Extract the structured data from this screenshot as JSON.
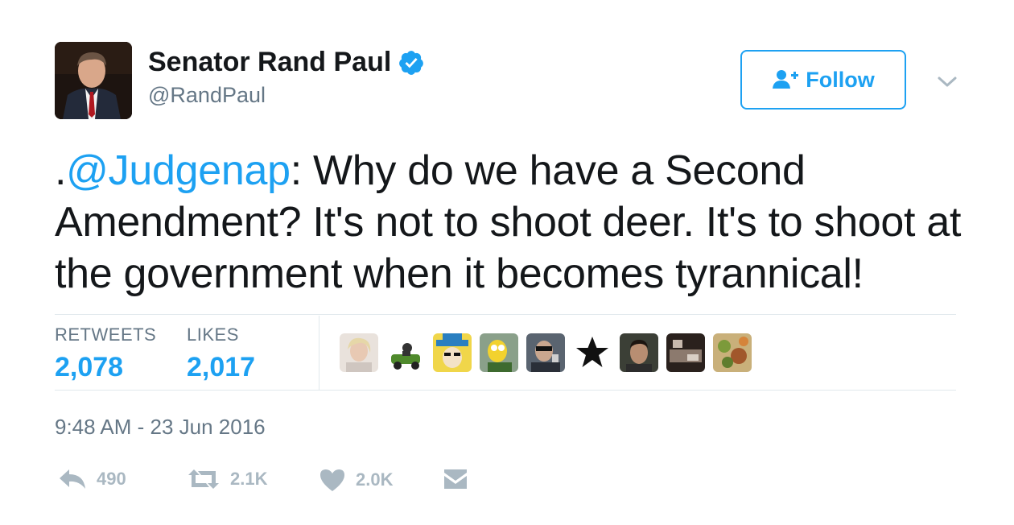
{
  "tweet": {
    "display_name": "Senator Rand Paul",
    "handle": "@RandPaul",
    "verified_icon": "verified-badge-icon",
    "follow_label": "Follow",
    "text_prefix": ".",
    "mention": "@Judgenap",
    "text_body": ": Why do we have a Second Amendment? It's not to shoot deer. It's to shoot at the government when it becomes tyrannical!",
    "timestamp": "9:48 AM - 23 Jun 2016"
  },
  "stats": {
    "retweets_label": "RETWEETS",
    "retweets_value": "2,078",
    "likes_label": "LIKES",
    "likes_value": "2,017"
  },
  "actions": {
    "reply_count": "490",
    "retweet_count": "2.1K",
    "like_count": "2.0K"
  },
  "colors": {
    "accent": "#1da1f2",
    "muted": "#657786",
    "icon": "#aab8c2",
    "text": "#14171a"
  }
}
